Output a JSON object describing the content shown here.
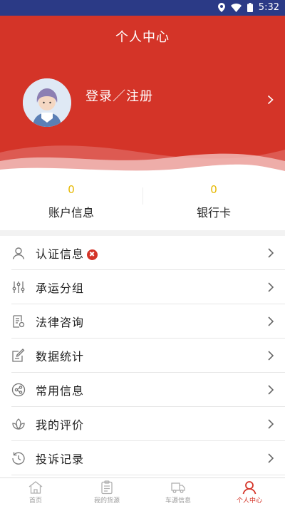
{
  "status_bar": {
    "time": "5:32",
    "icons": [
      "location-icon",
      "wifi-icon",
      "battery-icon"
    ]
  },
  "header": {
    "title": "个人中心",
    "login_label": "登录／注册"
  },
  "stats": [
    {
      "value": "0",
      "label": "账户信息"
    },
    {
      "value": "0",
      "label": "银行卡"
    }
  ],
  "menu": [
    {
      "label": "认证信息",
      "icon": "user-outline-icon",
      "badge": "✖"
    },
    {
      "label": "承运分组",
      "icon": "sliders-icon"
    },
    {
      "label": "法律咨询",
      "icon": "document-icon"
    },
    {
      "label": "数据统计",
      "icon": "edit-icon"
    },
    {
      "label": "常用信息",
      "icon": "share-icon"
    },
    {
      "label": "我的评价",
      "icon": "lotus-icon"
    },
    {
      "label": "投诉记录",
      "icon": "history-icon"
    }
  ],
  "tabbar": [
    {
      "label": "首页",
      "icon": "home-icon",
      "active": false
    },
    {
      "label": "我的货源",
      "icon": "clipboard-icon",
      "active": false
    },
    {
      "label": "车源信息",
      "icon": "truck-icon",
      "active": false
    },
    {
      "label": "个人中心",
      "icon": "person-icon",
      "active": true
    }
  ],
  "colors": {
    "accent": "#d43428",
    "status_bar": "#2b3a86",
    "stat_value": "#e6b800"
  }
}
